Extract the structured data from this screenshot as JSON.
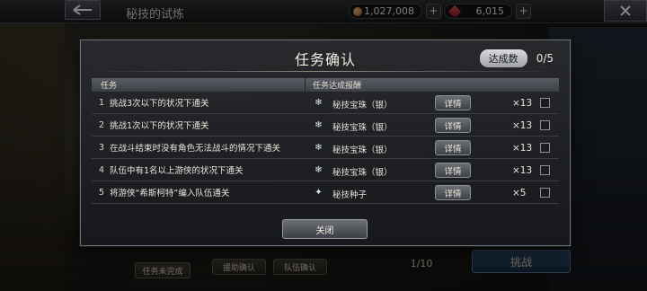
{
  "header": {
    "title": "秘技的试炼",
    "coins": "1,027,008",
    "gems": "6,015"
  },
  "background_buttons": {
    "left_button": "任务未完成",
    "team_confirm": "队伍确认",
    "assist_confirm": "援助确认",
    "page": "1/10",
    "challenge": "挑战"
  },
  "dialog": {
    "title": "任务确认",
    "achievement_label": "达成数",
    "achievement_value": "0/5",
    "col_task": "任务",
    "col_reward": "任务达成报酬",
    "detail_label": "详情",
    "close_label": "关闭",
    "rows": [
      {
        "num": "1",
        "desc": "挑战3次以下的状况下通关",
        "reward": "秘技宝珠（银）",
        "icon": "snowflake-orb-icon",
        "qty": "×13"
      },
      {
        "num": "2",
        "desc": "挑战1次以下的状况下通关",
        "reward": "秘技宝珠（银）",
        "icon": "snowflake-orb-icon",
        "qty": "×13"
      },
      {
        "num": "3",
        "desc": "在战斗结束时没有角色无法战斗的情况下通关",
        "reward": "秘技宝珠（银）",
        "icon": "snowflake-orb-icon",
        "qty": "×13"
      },
      {
        "num": "4",
        "desc": "队伍中有1名以上游侠的状况下通关",
        "reward": "秘技宝珠（银）",
        "icon": "snowflake-orb-icon",
        "qty": "×13"
      },
      {
        "num": "5",
        "desc": "将游侠“希斯柯特”编入队伍通关",
        "reward": "秘技种子",
        "icon": "star-seed-icon",
        "qty": "×5"
      }
    ]
  }
}
